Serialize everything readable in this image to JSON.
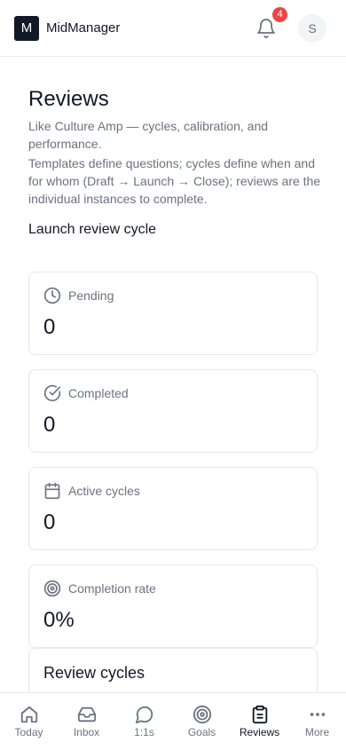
{
  "header": {
    "logo_letter": "M",
    "app_name": "MidManager",
    "notification_count": "4",
    "avatar_initial": "S"
  },
  "main": {
    "title": "Reviews",
    "subtitle_1": "Like Culture Amp — cycles, calibration, and performance.",
    "subtitle_2": "Templates define questions; cycles define when and for whom (Draft → Launch → Close); reviews are the individual instances to complete.",
    "launch_button": "Launch review cycle"
  },
  "stats": [
    {
      "label": "Pending",
      "value": "0",
      "icon": "clock-icon"
    },
    {
      "label": "Completed",
      "value": "0",
      "icon": "check-circle-icon"
    },
    {
      "label": "Active cycles",
      "value": "0",
      "icon": "calendar-icon"
    },
    {
      "label": "Completion rate",
      "value": "0%",
      "icon": "target-icon"
    }
  ],
  "cycles": {
    "title": "Review cycles"
  },
  "nav": [
    {
      "label": "Today",
      "icon": "home-icon"
    },
    {
      "label": "Inbox",
      "icon": "inbox-icon"
    },
    {
      "label": "1:1s",
      "icon": "chat-icon"
    },
    {
      "label": "Goals",
      "icon": "target-icon"
    },
    {
      "label": "Reviews",
      "icon": "clipboard-icon",
      "active": true
    },
    {
      "label": "More",
      "icon": "more-icon"
    }
  ],
  "colors": {
    "accent": "#111827",
    "badge": "#ef4444",
    "muted": "#6b7280",
    "border": "#e5e7eb"
  }
}
